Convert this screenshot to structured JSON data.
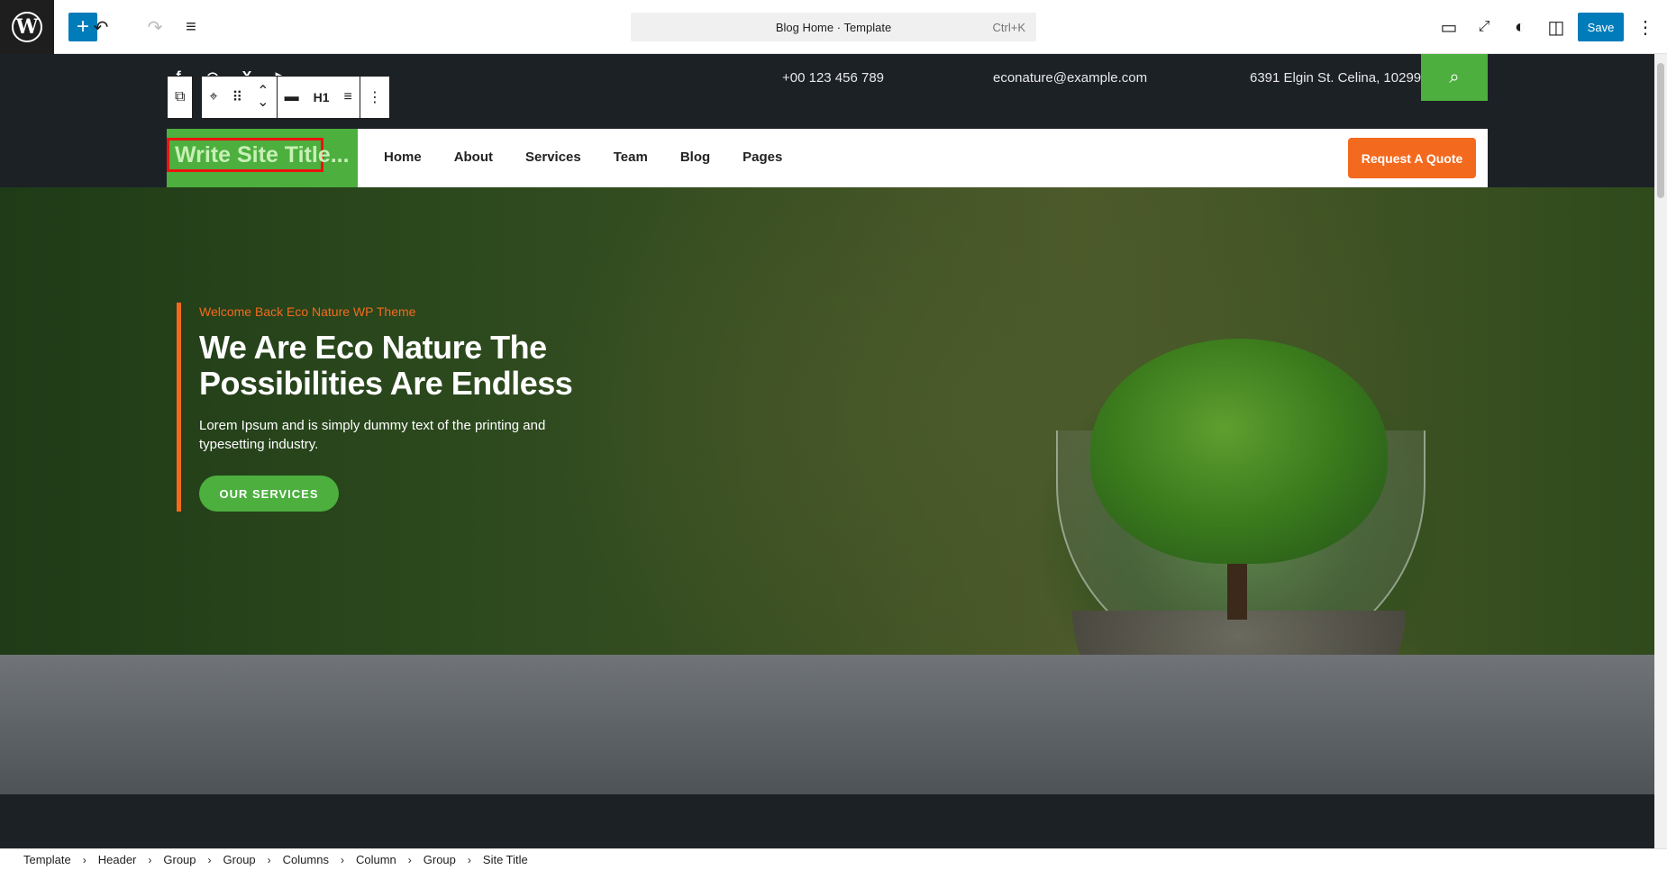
{
  "editor": {
    "document_title": "Blog Home · Template",
    "shortcut": "Ctrl+K",
    "save_label": "Save"
  },
  "topbar_icons": {
    "logo": "wordpress-icon",
    "add": "+",
    "undo": "↶",
    "redo": "↷",
    "list_view": "≡",
    "view": "▭",
    "fullscreen": "⤢",
    "styles": "◐",
    "settings": "◫",
    "options": "⋮"
  },
  "header": {
    "social": [
      "f",
      "◎",
      "X",
      "▶"
    ],
    "phone": "+00 123 456 789",
    "email": "econature@example.com",
    "address": "6391 Elgin St. Celina, 10299",
    "search_icon": "⌕"
  },
  "block_toolbar": {
    "transform": "⧉",
    "pin": "⌖",
    "drag": "⠿",
    "up": "⌃",
    "down": "⌄",
    "align": "▬",
    "heading": "H1",
    "text_align": "≡",
    "more": "⋮"
  },
  "site": {
    "title": "Write Site Title...",
    "nav": [
      "Home",
      "About",
      "Services",
      "Team",
      "Blog",
      "Pages"
    ],
    "quote_button": "Request A Quote"
  },
  "hero": {
    "kicker": "Welcome Back Eco Nature WP Theme",
    "title": "We Are Eco Nature The Possibilities Are Endless",
    "description": "Lorem Ipsum and is simply dummy text of the printing and typesetting industry.",
    "button": "OUR SERVICES"
  },
  "breadcrumb": [
    "Template",
    "Header",
    "Group",
    "Group",
    "Columns",
    "Column",
    "Group",
    "Site Title"
  ],
  "colors": {
    "accent": "#007cba",
    "green": "#4caf3e",
    "orange": "#f36a1e",
    "selection": "#e11111"
  }
}
